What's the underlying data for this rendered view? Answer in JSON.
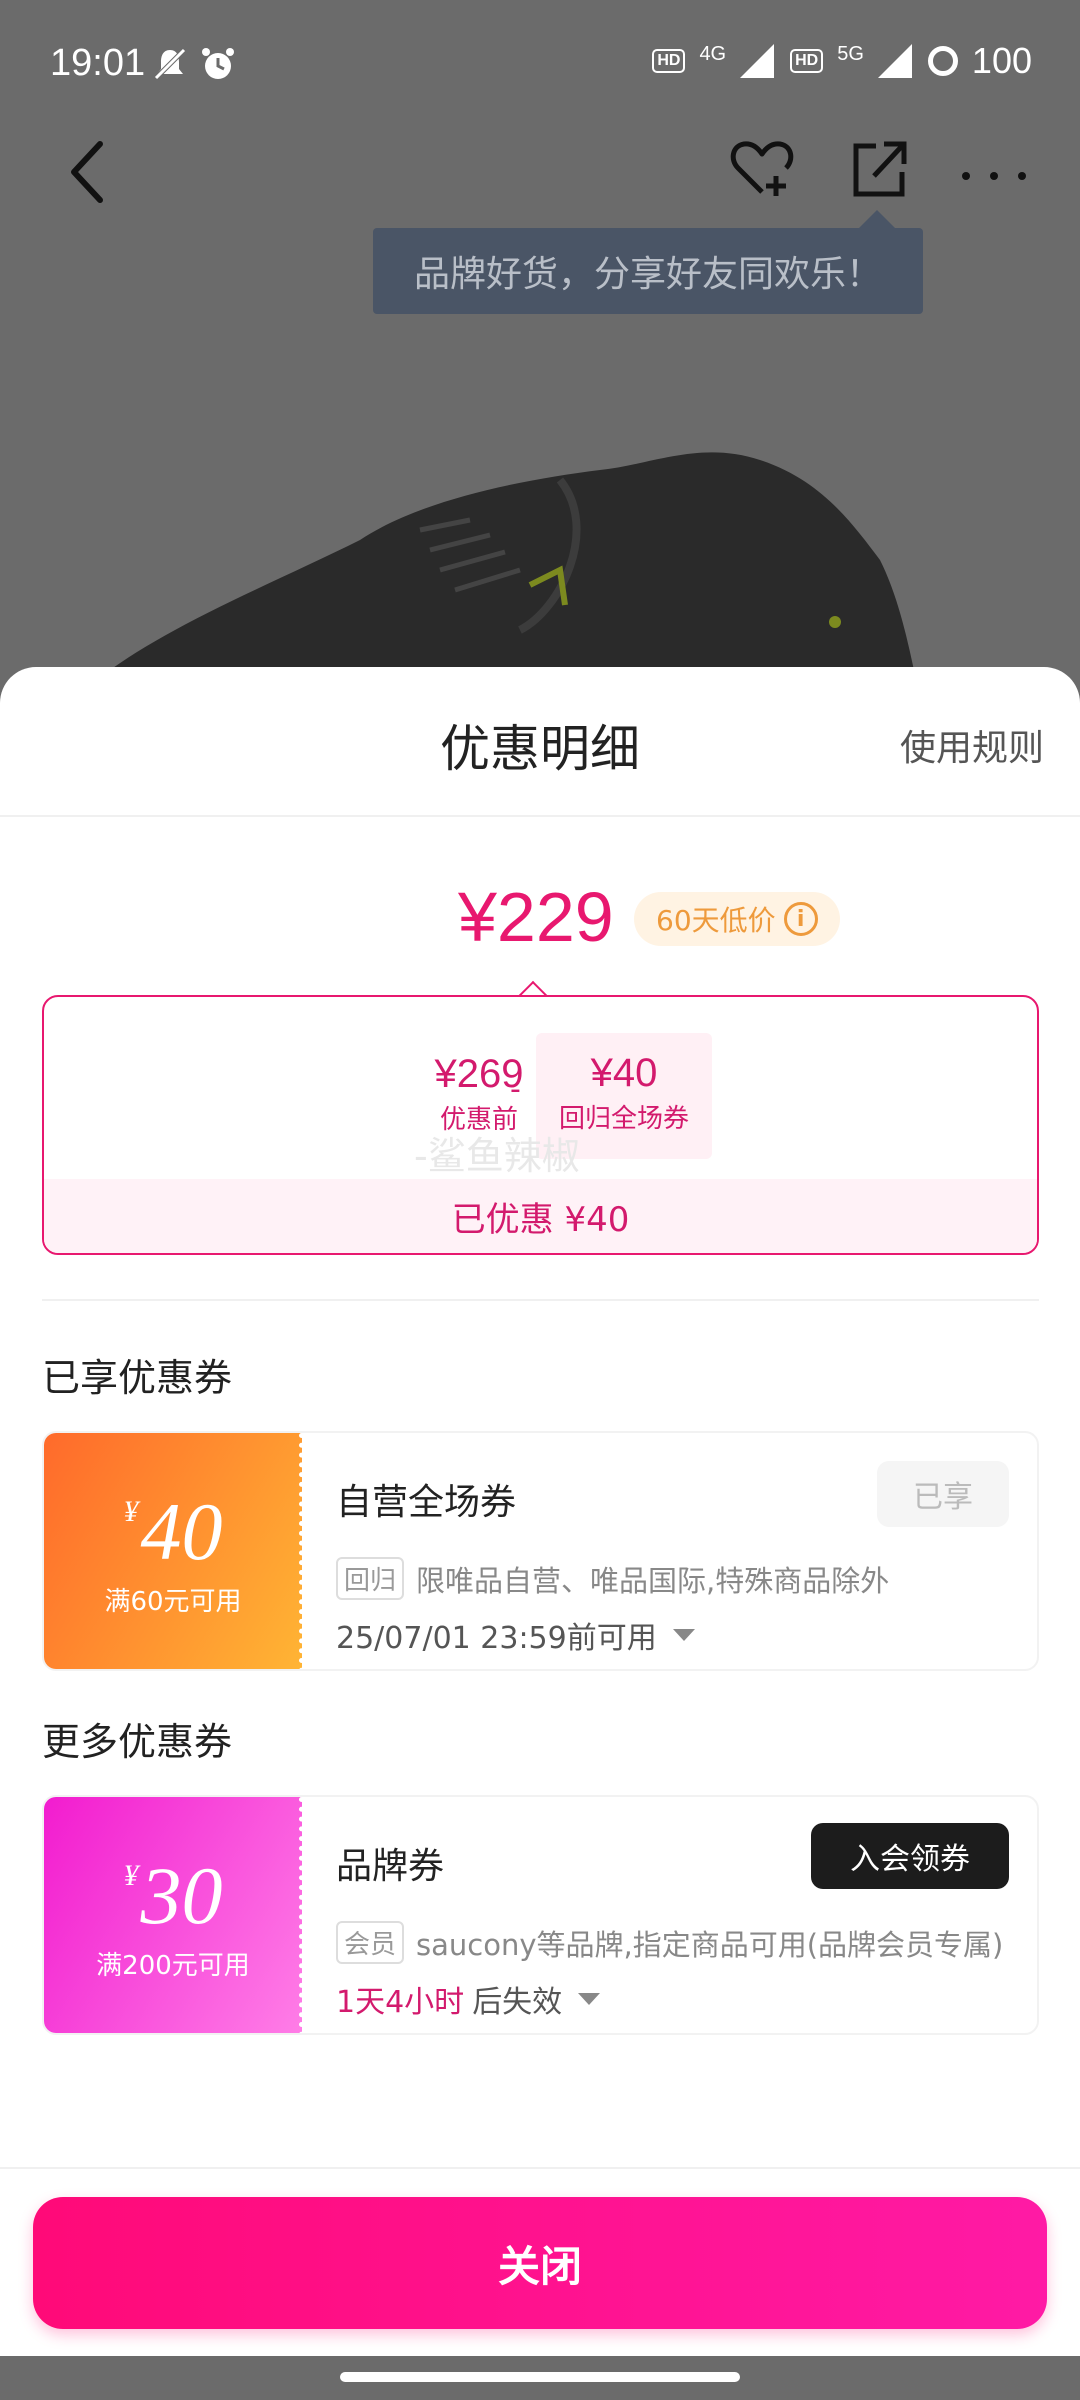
{
  "status_bar": {
    "time": "19:01",
    "network_1": "4G",
    "network_2": "5G",
    "hd": "HD",
    "battery": "100"
  },
  "tooltip": {
    "text": "品牌好货，分享好友同欢乐！"
  },
  "sheet": {
    "title": "优惠明细",
    "rules_link": "使用规则",
    "final_price": "¥229",
    "low_price_badge": "60天低价",
    "info_symbol": "i",
    "breakdown": {
      "original_price": "¥269",
      "original_label": "优惠前",
      "minus": "-",
      "coupon_price": "¥40",
      "coupon_label": "回归全场券",
      "watermark": "-鲨鱼辣椒",
      "saved_text": "已优惠 ¥40"
    },
    "enjoyed_section": {
      "title": "已享优惠券",
      "coupon": {
        "currency": "¥",
        "amount": "40",
        "condition": "满60元可用",
        "name": "自营全场券",
        "status_button": "已享",
        "tag": "回归",
        "description": "限唯品自营、唯品国际,特殊商品除外",
        "validity": "25/07/01 23:59前可用"
      }
    },
    "more_section": {
      "title": "更多优惠券",
      "coupon": {
        "currency": "¥",
        "amount": "30",
        "condition": "满200元可用",
        "name": "品牌券",
        "action_button": "入会领券",
        "tag": "会员",
        "description": "saucony等品牌,指定商品可用(品牌会员专属)",
        "expire_highlight": "1天4小时",
        "expire_suffix": "后失效"
      }
    },
    "close_button": "关闭"
  }
}
